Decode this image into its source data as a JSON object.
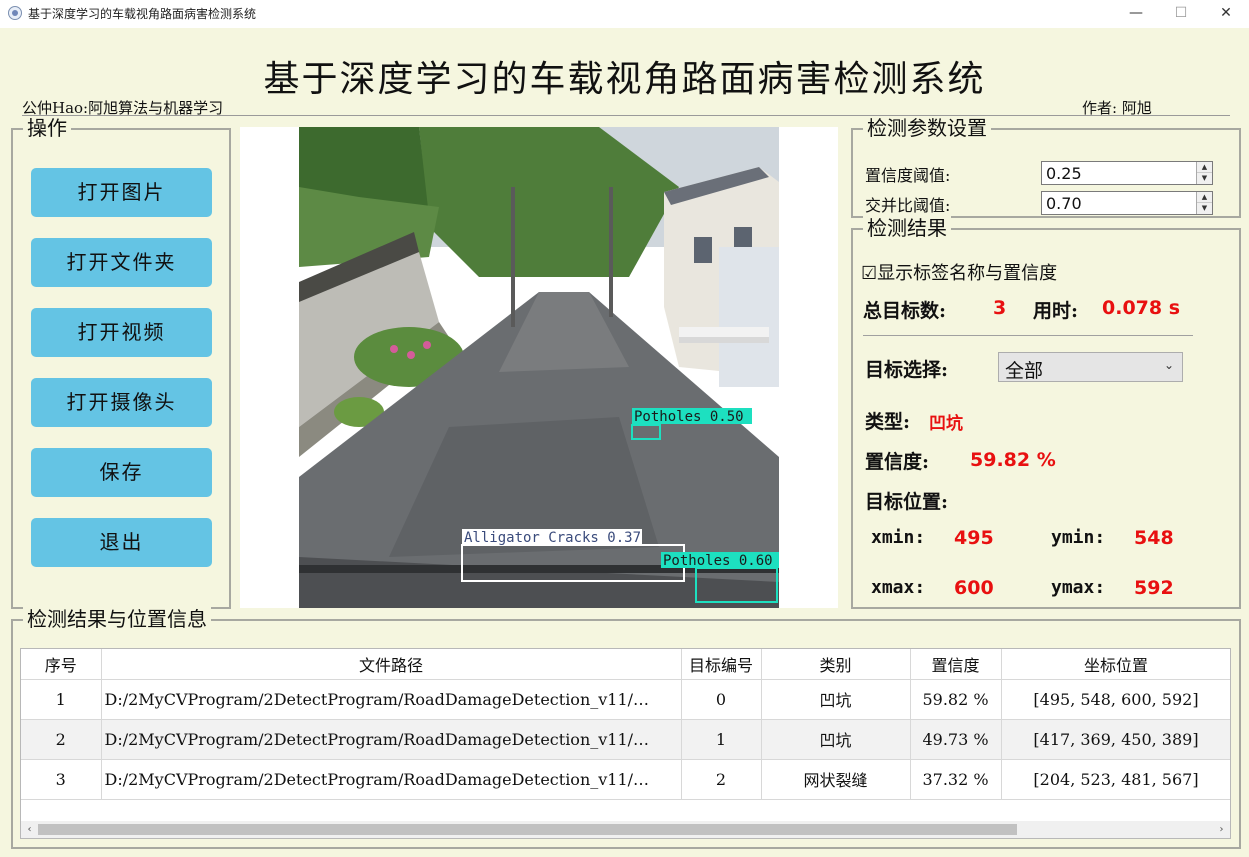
{
  "window": {
    "title": "基于深度学习的车载视角路面病害检测系统",
    "minimize_glyph": "—",
    "maximize_glyph": "☐",
    "close_glyph": "✕"
  },
  "header": {
    "title": "基于深度学习的车载视角路面病害检测系统",
    "left_caption": "公仲Hao:阿旭算法与机器学习",
    "right_caption": "作者: 阿旭"
  },
  "operations": {
    "legend": "操作",
    "buttons": [
      "打开图片",
      "打开文件夹",
      "打开视频",
      "打开摄像头",
      "保存",
      "退出"
    ]
  },
  "image_view": {
    "detections": [
      {
        "label": "Potholes  0.50"
      },
      {
        "label": "Alligator Cracks  0.37"
      },
      {
        "label": "Potholes  0.60"
      }
    ]
  },
  "params": {
    "legend": "检测参数设置",
    "confidence_label": "置信度阈值:",
    "confidence_value": "0.25",
    "iou_label": "交并比阈值:",
    "iou_value": "0.70"
  },
  "results": {
    "legend": "检测结果",
    "show_labels_text": "☑显示标签名称与置信度",
    "total_label": "总目标数:",
    "total_value": "3",
    "time_label": "用时:",
    "time_value": "0.078 s",
    "target_select_label": "目标选择:",
    "target_select_value": "全部",
    "type_label": "类型:",
    "type_value": "凹坑",
    "confidence_label": "置信度:",
    "confidence_value": "59.82 %",
    "position_label": "目标位置:",
    "xmin_label": "xmin:",
    "xmin_value": "495",
    "ymin_label": "ymin:",
    "ymin_value": "548",
    "xmax_label": "xmax:",
    "xmax_value": "600",
    "ymax_label": "ymax:",
    "ymax_value": "592"
  },
  "table": {
    "legend": "检测结果与位置信息",
    "headers": [
      "序号",
      "文件路径",
      "目标编号",
      "类别",
      "置信度",
      "坐标位置"
    ],
    "rows": [
      [
        "1",
        "D:/2MyCVProgram/2DetectProgram/RoadDamageDetection_v11/…",
        "0",
        "凹坑",
        "59.82 %",
        "[495, 548, 600, 592]"
      ],
      [
        "2",
        "D:/2MyCVProgram/2DetectProgram/RoadDamageDetection_v11/…",
        "1",
        "凹坑",
        "49.73 %",
        "[417, 369, 450, 389]"
      ],
      [
        "3",
        "D:/2MyCVProgram/2DetectProgram/RoadDamageDetection_v11/…",
        "2",
        "网状裂缝",
        "37.32 %",
        "[204, 523, 481, 567]"
      ]
    ],
    "scroll_left_glyph": "‹",
    "scroll_right_glyph": "›"
  },
  "colors": {
    "background": "#f5f6df",
    "button": "#64c4e4",
    "value_red": "#e81010",
    "detection_box": "#1de0c0",
    "crack_box": "#ffffff"
  }
}
